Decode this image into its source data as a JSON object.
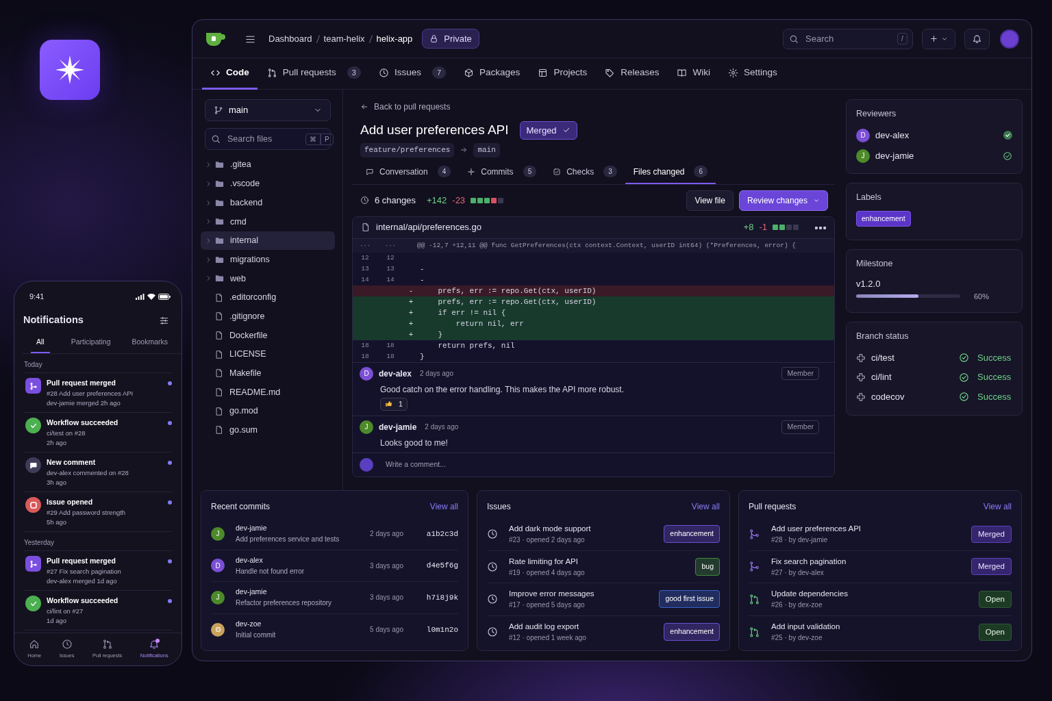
{
  "phone": {
    "time": "9:41",
    "title": "Notifications",
    "tabs": [
      {
        "label": "All",
        "selected": true
      },
      {
        "label": "Participating",
        "selected": false
      },
      {
        "label": "Bookmarks",
        "selected": false
      }
    ],
    "sections": [
      {
        "heading": "Today",
        "items": [
          {
            "kind": "merged",
            "title": "Pull request merged",
            "detail": "#28 Add user preferences API",
            "time": "dev-jamie merged 2h ago",
            "unread": true
          },
          {
            "kind": "success",
            "title": "Workflow succeeded",
            "detail": "ci/test on #28",
            "time": "2h ago",
            "unread": true
          },
          {
            "kind": "comment",
            "title": "New comment",
            "detail": "dev-alex commented on #28",
            "time": "3h ago",
            "unread": true
          },
          {
            "kind": "issue",
            "title": "Issue opened",
            "detail": "#29 Add password strength",
            "time": "5h ago",
            "unread": true
          }
        ]
      },
      {
        "heading": "Yesterday",
        "items": [
          {
            "kind": "merged",
            "title": "Pull request merged",
            "detail": "#27 Fix search pagination",
            "time": "dev-alex merged 1d ago",
            "unread": true
          },
          {
            "kind": "success",
            "title": "Workflow succeeded",
            "detail": "ci/lint on #27",
            "time": "1d ago",
            "unread": true
          }
        ]
      }
    ],
    "nav": [
      {
        "label": "Home",
        "selected": false,
        "badge": false
      },
      {
        "label": "Issues",
        "selected": false,
        "badge": false
      },
      {
        "label": "Pull requests",
        "selected": false,
        "badge": false
      },
      {
        "label": "Notifications",
        "selected": true,
        "badge": true
      }
    ]
  },
  "repo": {
    "breadcrumb": [
      "Dashboard",
      "team-helix",
      "helix-app"
    ],
    "visibility": "Private",
    "search": {
      "placeholder": "Search",
      "shortcut": "/"
    }
  },
  "repo_tabs": [
    {
      "label": "Code",
      "selected": true
    },
    {
      "label": "Pull requests",
      "count": "3",
      "selected": false
    },
    {
      "label": "Issues",
      "count": "7",
      "selected": false
    },
    {
      "label": "Packages",
      "selected": false
    },
    {
      "label": "Projects",
      "selected": false
    },
    {
      "label": "Releases",
      "selected": false
    },
    {
      "label": "Wiki",
      "selected": false
    },
    {
      "label": "Settings",
      "selected": false
    }
  ],
  "file_tree": {
    "branch": "main",
    "search": {
      "placeholder": "Search files",
      "keys": [
        "⌘",
        "P"
      ]
    },
    "items": [
      {
        "name": ".gitea",
        "kind": "folder",
        "selected": false
      },
      {
        "name": ".vscode",
        "kind": "folder",
        "selected": false
      },
      {
        "name": "backend",
        "kind": "folder",
        "selected": false
      },
      {
        "name": "cmd",
        "kind": "folder",
        "selected": false
      },
      {
        "name": "internal",
        "kind": "folder",
        "selected": true
      },
      {
        "name": "migrations",
        "kind": "folder",
        "selected": false
      },
      {
        "name": "web",
        "kind": "folder",
        "selected": false
      },
      {
        "name": ".editorconfig",
        "kind": "file",
        "selected": false
      },
      {
        "name": ".gitignore",
        "kind": "file",
        "selected": false
      },
      {
        "name": "Dockerfile",
        "kind": "file",
        "selected": false
      },
      {
        "name": "LICENSE",
        "kind": "file",
        "selected": false
      },
      {
        "name": "Makefile",
        "kind": "file",
        "selected": false
      },
      {
        "name": "README.md",
        "kind": "file",
        "selected": false
      },
      {
        "name": "go.mod",
        "kind": "file",
        "selected": false
      },
      {
        "name": "go.sum",
        "kind": "file",
        "selected": false
      }
    ]
  },
  "pull_request": {
    "back": "Back to pull requests",
    "title": "Add user preferences API",
    "state": "Merged",
    "head": "feature/preferences",
    "base": "main",
    "tabs": [
      {
        "label": "Conversation",
        "count": "4",
        "selected": false
      },
      {
        "label": "Commits",
        "count": "5",
        "selected": false
      },
      {
        "label": "Checks",
        "count": "3",
        "selected": false
      },
      {
        "label": "Files changed",
        "count": "6",
        "selected": true
      }
    ],
    "summary": {
      "changes": "6 changes",
      "additions": "+142",
      "deletions": "-23",
      "stat": [
        {
          "color": "#4caf6a"
        },
        {
          "color": "#4caf6a"
        },
        {
          "color": "#4caf6a"
        },
        {
          "color": "#d9505f"
        },
        {
          "color": "#3a3850"
        }
      ]
    },
    "view_file": "View file",
    "review": "Review changes",
    "file": {
      "path": "internal/api/preferences.go",
      "additions": "+8",
      "deletions": "-1",
      "stat": [
        {
          "color": "#4caf6a"
        },
        {
          "color": "#4caf6a"
        },
        {
          "color": "#3a3850"
        },
        {
          "color": "#3a3850"
        }
      ]
    },
    "hunk": {
      "old": "···",
      "new": "···",
      "text": "@@ -12,7 +12,11 @@ func GetPreferences(ctx context.Context, userID int64) (*Preferences, error) {"
    },
    "lines": [
      {
        "kind": "context",
        "old": "12",
        "new": "12"
      },
      {
        "kind": "context",
        "old": "13",
        "new": "13",
        "code": "-"
      },
      {
        "kind": "context",
        "old": "14",
        "new": "14",
        "code": "-"
      },
      {
        "kind": "del",
        "sign": "-",
        "code": "    prefs, err := repo.Get(ctx, userID)"
      },
      {
        "kind": "add",
        "sign": "+",
        "code": "    prefs, err := repo.Get(ctx, userID)"
      },
      {
        "kind": "add",
        "sign": "+",
        "code": "    if err != nil {"
      },
      {
        "kind": "add",
        "sign": "+",
        "code": "        return nil, err"
      },
      {
        "kind": "add",
        "sign": "+",
        "code": "    }"
      },
      {
        "kind": "context",
        "old": "18",
        "new": "18",
        "code": "    return prefs, nil"
      },
      {
        "kind": "context",
        "old": "18",
        "new": "18",
        "code": "}"
      }
    ],
    "comments": [
      {
        "author": "dev-alex",
        "initial": "D",
        "color": "#7b4fd6",
        "time": "2 days ago",
        "role": "Member",
        "body": "Good catch on the error handling. This makes the API more robust.",
        "reaction_count": "1"
      },
      {
        "author": "dev-jamie",
        "initial": "J",
        "color": "#4d8a2a",
        "time": "2 days ago",
        "role": "Member",
        "body": "Looks good to me!"
      }
    ],
    "comment_placeholder": "Write a comment..."
  },
  "sidebar": {
    "reviewers_title": "Reviewers",
    "reviewers": [
      {
        "name": "dev-alex",
        "initial": "D",
        "color": "#7b4fd6",
        "kind": "approved"
      },
      {
        "name": "dev-jamie",
        "initial": "J",
        "color": "#4d8a2a",
        "kind": "reviewed"
      }
    ],
    "labels_title": "Labels",
    "labels": [
      "enhancement"
    ],
    "milestone_title": "Milestone",
    "milestone": {
      "name": "v1.2.0",
      "level": 0.6,
      "percent": "60%"
    },
    "status_title": "Branch status",
    "checks": [
      {
        "name": "ci/test",
        "status": "Success"
      },
      {
        "name": "ci/lint",
        "status": "Success"
      },
      {
        "name": "codecov",
        "status": "Success"
      }
    ]
  },
  "commits": {
    "title": "Recent commits",
    "link": "View all",
    "items": [
      {
        "author": "dev-jamie",
        "initial": "J",
        "color": "#4d8a2a",
        "message": "Add preferences service and tests",
        "time": "2 days ago",
        "sha": "a1b2c3d"
      },
      {
        "author": "dev-alex",
        "initial": "D",
        "color": "#7b4fd6",
        "message": "Handle not found error",
        "time": "3 days ago",
        "sha": "d4e5f6g"
      },
      {
        "author": "dev-jamie",
        "initial": "J",
        "color": "#4d8a2a",
        "message": "Refactor preferences repository",
        "time": "3 days ago",
        "sha": "h7i8j9k"
      },
      {
        "author": "dev-zoe",
        "color": "#c9a15a",
        "message": "Initial commit",
        "time": "5 days ago",
        "sha": "l0m1n2o"
      }
    ]
  },
  "issues": {
    "title": "Issues",
    "link": "View all",
    "items": [
      {
        "title": "Add dark mode support",
        "meta": "#23 · opened 2 days ago",
        "label": "enhancement",
        "color": "#6a4fd0"
      },
      {
        "title": "Rate limiting for API",
        "meta": "#19 · opened 4 days ago",
        "label": "bug",
        "color": "#3f8a3a"
      },
      {
        "title": "Improve error messages",
        "meta": "#17 · opened 5 days ago",
        "label": "good first issue",
        "color": "#3a63c8"
      },
      {
        "title": "Add audit log export",
        "meta": "#12 · opened 1 week ago",
        "label": "enhancement",
        "color": "#6a4fd0"
      }
    ]
  },
  "pull_requests": {
    "title": "Pull requests",
    "link": "View all",
    "items": [
      {
        "title": "Add user preferences API",
        "meta": "#28 · by dev-jamie",
        "state": "Merged",
        "kind": "merged"
      },
      {
        "title": "Fix search pagination",
        "meta": "#27 · by dev-alex",
        "state": "Merged",
        "kind": "merged"
      },
      {
        "title": "Update dependencies",
        "meta": "#26 · by dex-zoe",
        "state": "Open",
        "kind": "open"
      },
      {
        "title": "Add input validation",
        "meta": "#25 · by dev-zoe",
        "state": "Open",
        "kind": "open"
      }
    ]
  }
}
